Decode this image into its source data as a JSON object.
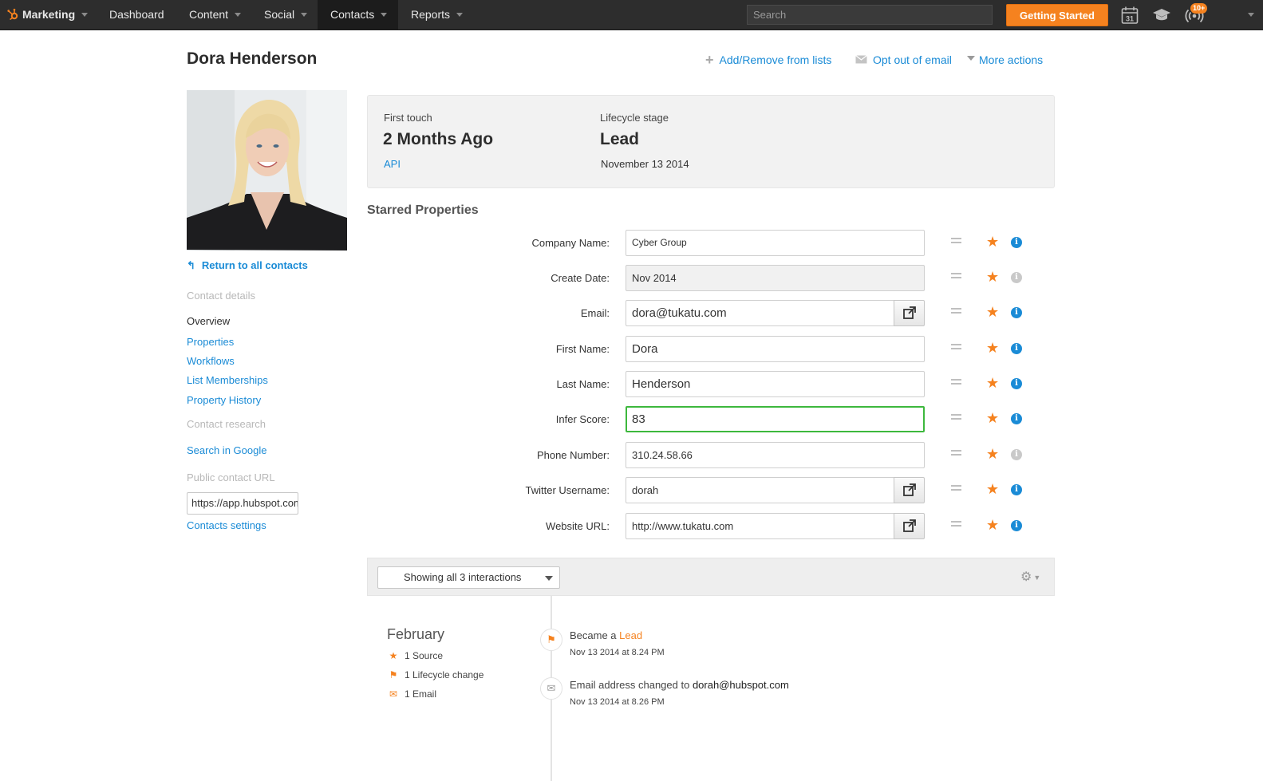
{
  "nav": {
    "brand": "Marketing",
    "items": [
      "Dashboard",
      "Content",
      "Social",
      "Contacts",
      "Reports"
    ],
    "search_placeholder": "Search",
    "getting_started": "Getting Started",
    "calendar_day": "31",
    "notif_badge": "10+"
  },
  "contact": {
    "name": "Dora Henderson"
  },
  "header_actions": {
    "add_remove": "Add/Remove from lists",
    "opt_out": "Opt out of email",
    "more": "More actions"
  },
  "left": {
    "return_link": "Return to all contacts",
    "contact_details_label": "Contact details",
    "overview": "Overview",
    "properties": "Properties",
    "workflows": "Workflows",
    "list_memberships": "List Memberships",
    "property_history": "Property History",
    "contact_research_label": "Contact research",
    "search_google": "Search in Google",
    "public_url_label": "Public contact URL",
    "public_url_value": "https://app.hubspot.com",
    "contacts_settings": "Contacts settings"
  },
  "summary": {
    "first_touch_label": "First touch",
    "first_touch_value": "2 Months Ago",
    "first_touch_source": "API",
    "lifecycle_label": "Lifecycle stage",
    "lifecycle_value": "Lead",
    "lifecycle_date": "November 13 2014"
  },
  "starred": {
    "title": "Starred Properties",
    "properties": [
      {
        "label": "Company Name:",
        "value": "Cyber Group",
        "info_active": true
      },
      {
        "label": "Create Date:",
        "value": "Nov 2014",
        "info_active": false
      },
      {
        "label": "Email:",
        "value": "dora@tukatu.com",
        "info_active": true
      },
      {
        "label": "First Name:",
        "value": "Dora",
        "info_active": true
      },
      {
        "label": "Last Name:",
        "value": "Henderson",
        "info_active": true
      },
      {
        "label": "Infer Score:",
        "value": "83",
        "info_active": true
      },
      {
        "label": "Phone Number:",
        "value": "310.24.58.66",
        "info_active": false
      },
      {
        "label": "Twitter Username:",
        "value": "dorah",
        "info_active": true
      },
      {
        "label": "Website URL:",
        "value": "http://www.tukatu.com",
        "info_active": true
      }
    ]
  },
  "interactions": {
    "filter_label": "Showing all 3 interactions"
  },
  "timeline": {
    "month": "February",
    "summary": [
      {
        "icon": "star-icon",
        "text": "1 Source"
      },
      {
        "icon": "flag-icon",
        "text": "1 Lifecycle change"
      },
      {
        "icon": "envelope-icon",
        "text": "1 Email"
      }
    ],
    "events": [
      {
        "icon": "flag-icon",
        "title_prefix": "Became a ",
        "title_highlight": "Lead",
        "time": "Nov 13 2014 at 8.24 PM"
      },
      {
        "icon": "envelope-icon",
        "title_prefix": "Email address changed to ",
        "title_highlight": "dorah@hubspot.com",
        "time": "Nov 13 2014 at 8.26 PM"
      }
    ]
  },
  "colors": {
    "accent_orange": "#f5821f",
    "link_blue": "#1a8bd6",
    "active_green": "#3db83d",
    "nav_bg": "#2d2d2d"
  }
}
